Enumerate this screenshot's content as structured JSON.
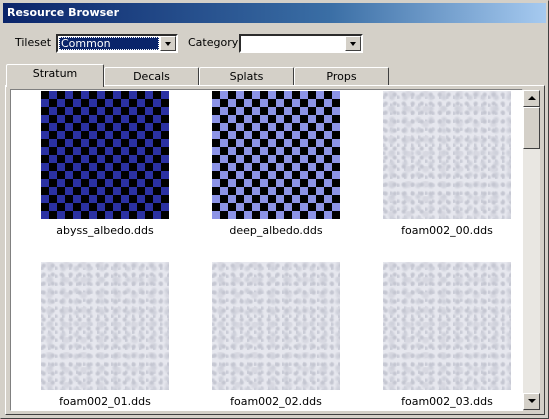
{
  "window": {
    "title": "Resource Browser"
  },
  "filters": {
    "tileset_label": "Tileset",
    "tileset_value": "Common",
    "category_label": "Category",
    "category_value": ""
  },
  "tabs": [
    {
      "label": "Stratum",
      "active": true
    },
    {
      "label": "Decals",
      "active": false
    },
    {
      "label": "Splats",
      "active": false
    },
    {
      "label": "Props",
      "active": false
    }
  ],
  "items": [
    {
      "name": "abyss_albedo.dds",
      "texture": "dark-blue-checker"
    },
    {
      "name": "deep_albedo.dds",
      "texture": "light-blue-checker"
    },
    {
      "name": "foam002_00.dds",
      "texture": "foam"
    },
    {
      "name": "foam002_01.dds",
      "texture": "foam"
    },
    {
      "name": "foam002_02.dds",
      "texture": "foam"
    },
    {
      "name": "foam002_03.dds",
      "texture": "foam"
    }
  ],
  "colors": {
    "title_gradient_start": "#0a246a",
    "selection": "#0a246a",
    "checker_dark": "#2b31a3",
    "checker_light": "#8c93e6"
  }
}
